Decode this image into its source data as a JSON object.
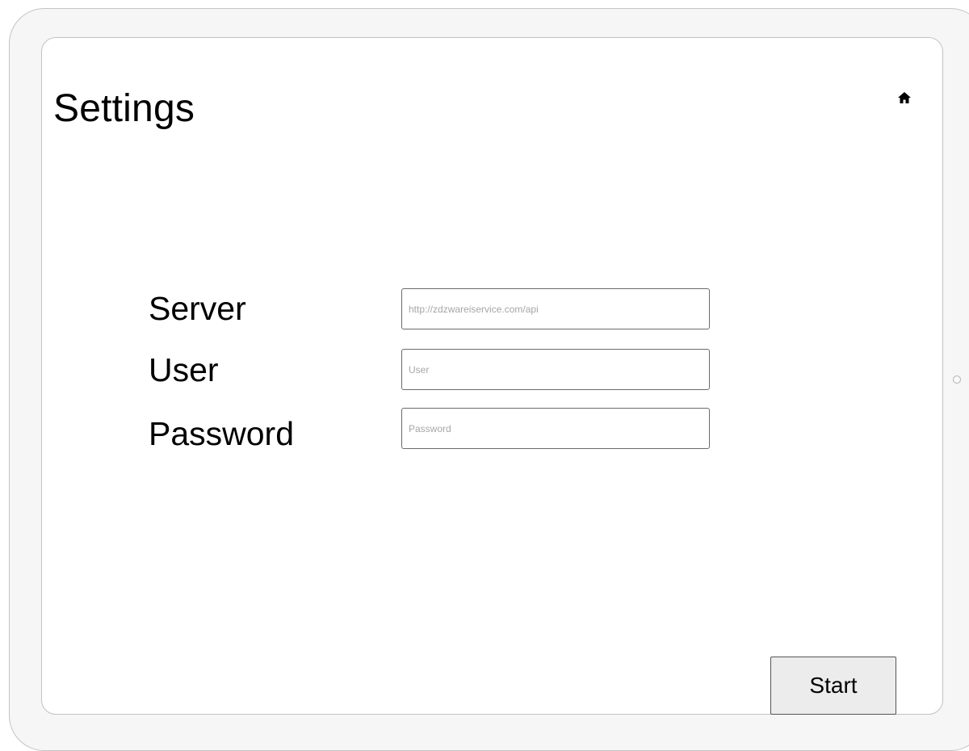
{
  "header": {
    "title": "Settings",
    "home_icon": "home-icon"
  },
  "form": {
    "server": {
      "label": "Server",
      "value": "",
      "placeholder": "http://zdzwareiservice.com/api"
    },
    "user": {
      "label": "User",
      "value": "",
      "placeholder": "User"
    },
    "password": {
      "label": "Password",
      "value": "",
      "placeholder": "Password"
    }
  },
  "actions": {
    "start_label": "Start"
  },
  "colors": {
    "frame": "#f6f6f6",
    "screen": "#ffffff",
    "button_bg": "#ececec",
    "input_border": "#6b6b6b",
    "placeholder": "#a6a6a6"
  }
}
